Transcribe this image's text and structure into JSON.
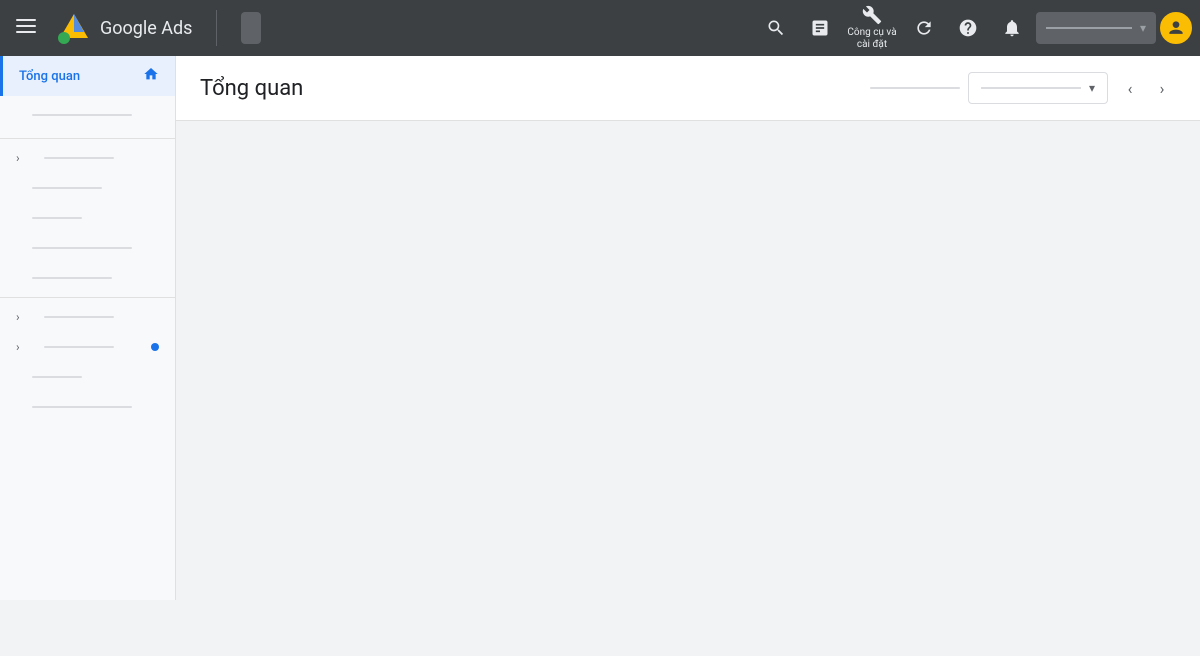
{
  "topnav": {
    "app_name": "Google Ads",
    "tools_label": "Công cụ và\ncài đặt"
  },
  "sidebar": {
    "active_item_label": "Tổng quan",
    "items": [
      {
        "id": "overview",
        "label": "Tổng quan",
        "active": true
      },
      {
        "id": "item1",
        "label": "",
        "has_chevron": false
      },
      {
        "id": "item2",
        "label": "",
        "has_chevron": true
      },
      {
        "id": "item3",
        "label": ""
      },
      {
        "id": "item4",
        "label": ""
      },
      {
        "id": "item5",
        "label": ""
      },
      {
        "id": "item6",
        "label": ""
      },
      {
        "id": "item7",
        "label": ""
      },
      {
        "id": "item8",
        "label": "",
        "has_chevron": true
      },
      {
        "id": "item9",
        "label": "",
        "has_chevron": true,
        "has_dot": true
      },
      {
        "id": "item10",
        "label": ""
      },
      {
        "id": "item11",
        "label": ""
      }
    ]
  },
  "main": {
    "title": "Tổng quan"
  },
  "icons": {
    "hamburger": "☰",
    "search": "🔍",
    "chart": "📊",
    "tools": "🔧",
    "refresh": "↻",
    "help": "?",
    "bell": "🔔",
    "chevron_down": "▾",
    "chevron_right": "›",
    "chevron_left": "‹",
    "home": "⌂"
  }
}
